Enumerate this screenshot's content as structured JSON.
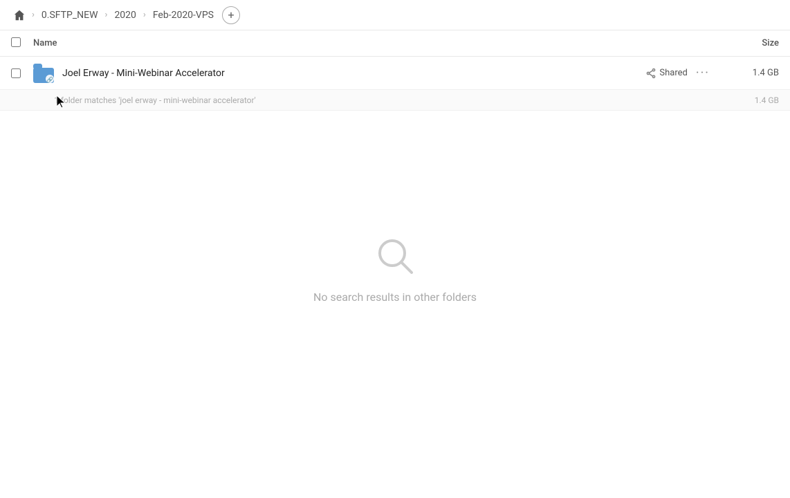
{
  "breadcrumb": {
    "home_icon": "home",
    "items": [
      {
        "label": "0.SFTP_NEW"
      },
      {
        "label": "2020"
      },
      {
        "label": "Feb-2020-VPS"
      }
    ],
    "add_button_label": "+"
  },
  "column_header": {
    "name_label": "Name",
    "size_label": "Size"
  },
  "file_row": {
    "name": "Joel Erway - Mini-Webinar Accelerator",
    "shared_label": "Shared",
    "size": "1.4 GB"
  },
  "match_row": {
    "text": "1 folder matches 'joel erway - mini-webinar accelerator'",
    "size": "1.4 GB"
  },
  "empty_state": {
    "icon": "search",
    "message": "No search results in other folders"
  }
}
